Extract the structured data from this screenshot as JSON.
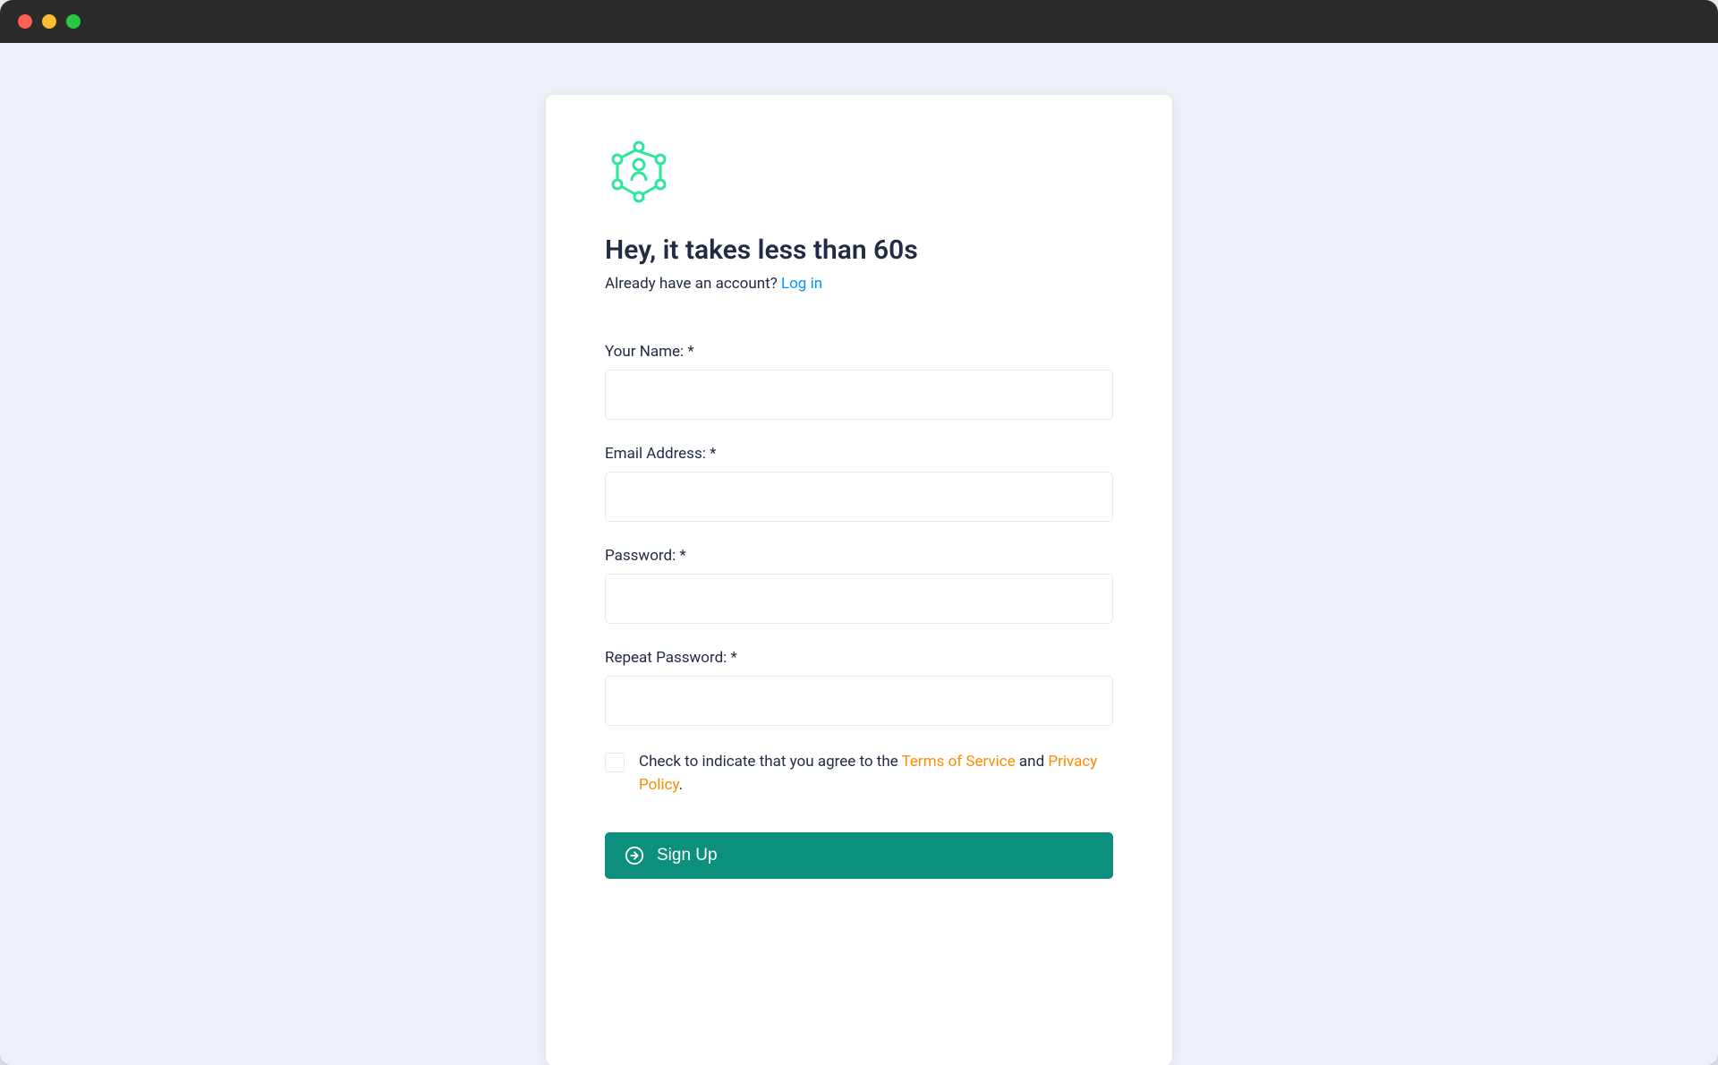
{
  "card": {
    "heading": "Hey, it takes less than 60s",
    "sub_prefix": "Already have an account? ",
    "login_link": "Log in"
  },
  "form": {
    "name_label": "Your Name: *",
    "email_label": "Email Address: *",
    "password_label": "Password: *",
    "repeat_label": "Repeat Password: *",
    "name_value": "",
    "email_value": "",
    "password_value": "",
    "repeat_value": ""
  },
  "terms": {
    "prefix": "Check to indicate that you agree to the ",
    "tos": "Terms of Service",
    "mid": " and ",
    "privacy": "Privacy Policy",
    "suffix": "."
  },
  "button": {
    "label": "Sign Up"
  },
  "colors": {
    "accent_teal": "#0d8f7d",
    "logo_green": "#2ce69b",
    "link_blue": "#0095ff",
    "link_orange": "#ff8a00",
    "page_bg": "#edf1f7",
    "text": "#222b45",
    "border": "#e4e9f2"
  },
  "icons": {
    "logo": "network-person-icon",
    "button_icon": "arrow-right-circle-icon"
  }
}
